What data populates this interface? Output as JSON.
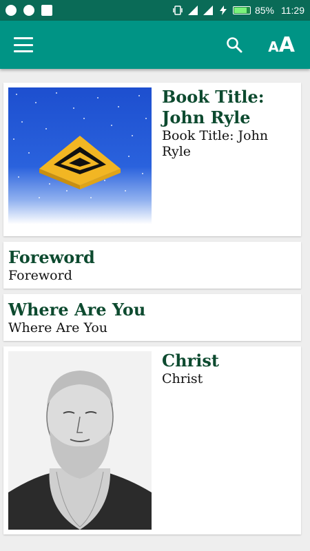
{
  "status_bar": {
    "battery_percent": "85%",
    "battery_level": 0.85,
    "time": "11:29",
    "icons": [
      "notification-icon",
      "browser-icon",
      "chat-icon",
      "vibrate-icon",
      "signal-icon",
      "signal-icon",
      "charging-icon",
      "battery-icon"
    ]
  },
  "app_bar": {
    "menu_icon": "hamburger-menu-icon",
    "search_icon": "search-icon",
    "text_size_icon": "text-size-icon",
    "text_size_small": "A",
    "text_size_big": "A",
    "background_color": "#009485"
  },
  "items": [
    {
      "title": "Book Title: John Ryle",
      "subtitle": "Book Title: John Ryle",
      "image": "pyramid-cover-image"
    },
    {
      "title": "Foreword",
      "subtitle": "Foreword"
    },
    {
      "title": "Where Are You",
      "subtitle": "Where Are You"
    },
    {
      "title": "Christ",
      "subtitle": "Christ",
      "image": "portrait-image"
    }
  ],
  "colors": {
    "title_text": "#0d4a2f",
    "status_bar": "#0a6b57"
  }
}
